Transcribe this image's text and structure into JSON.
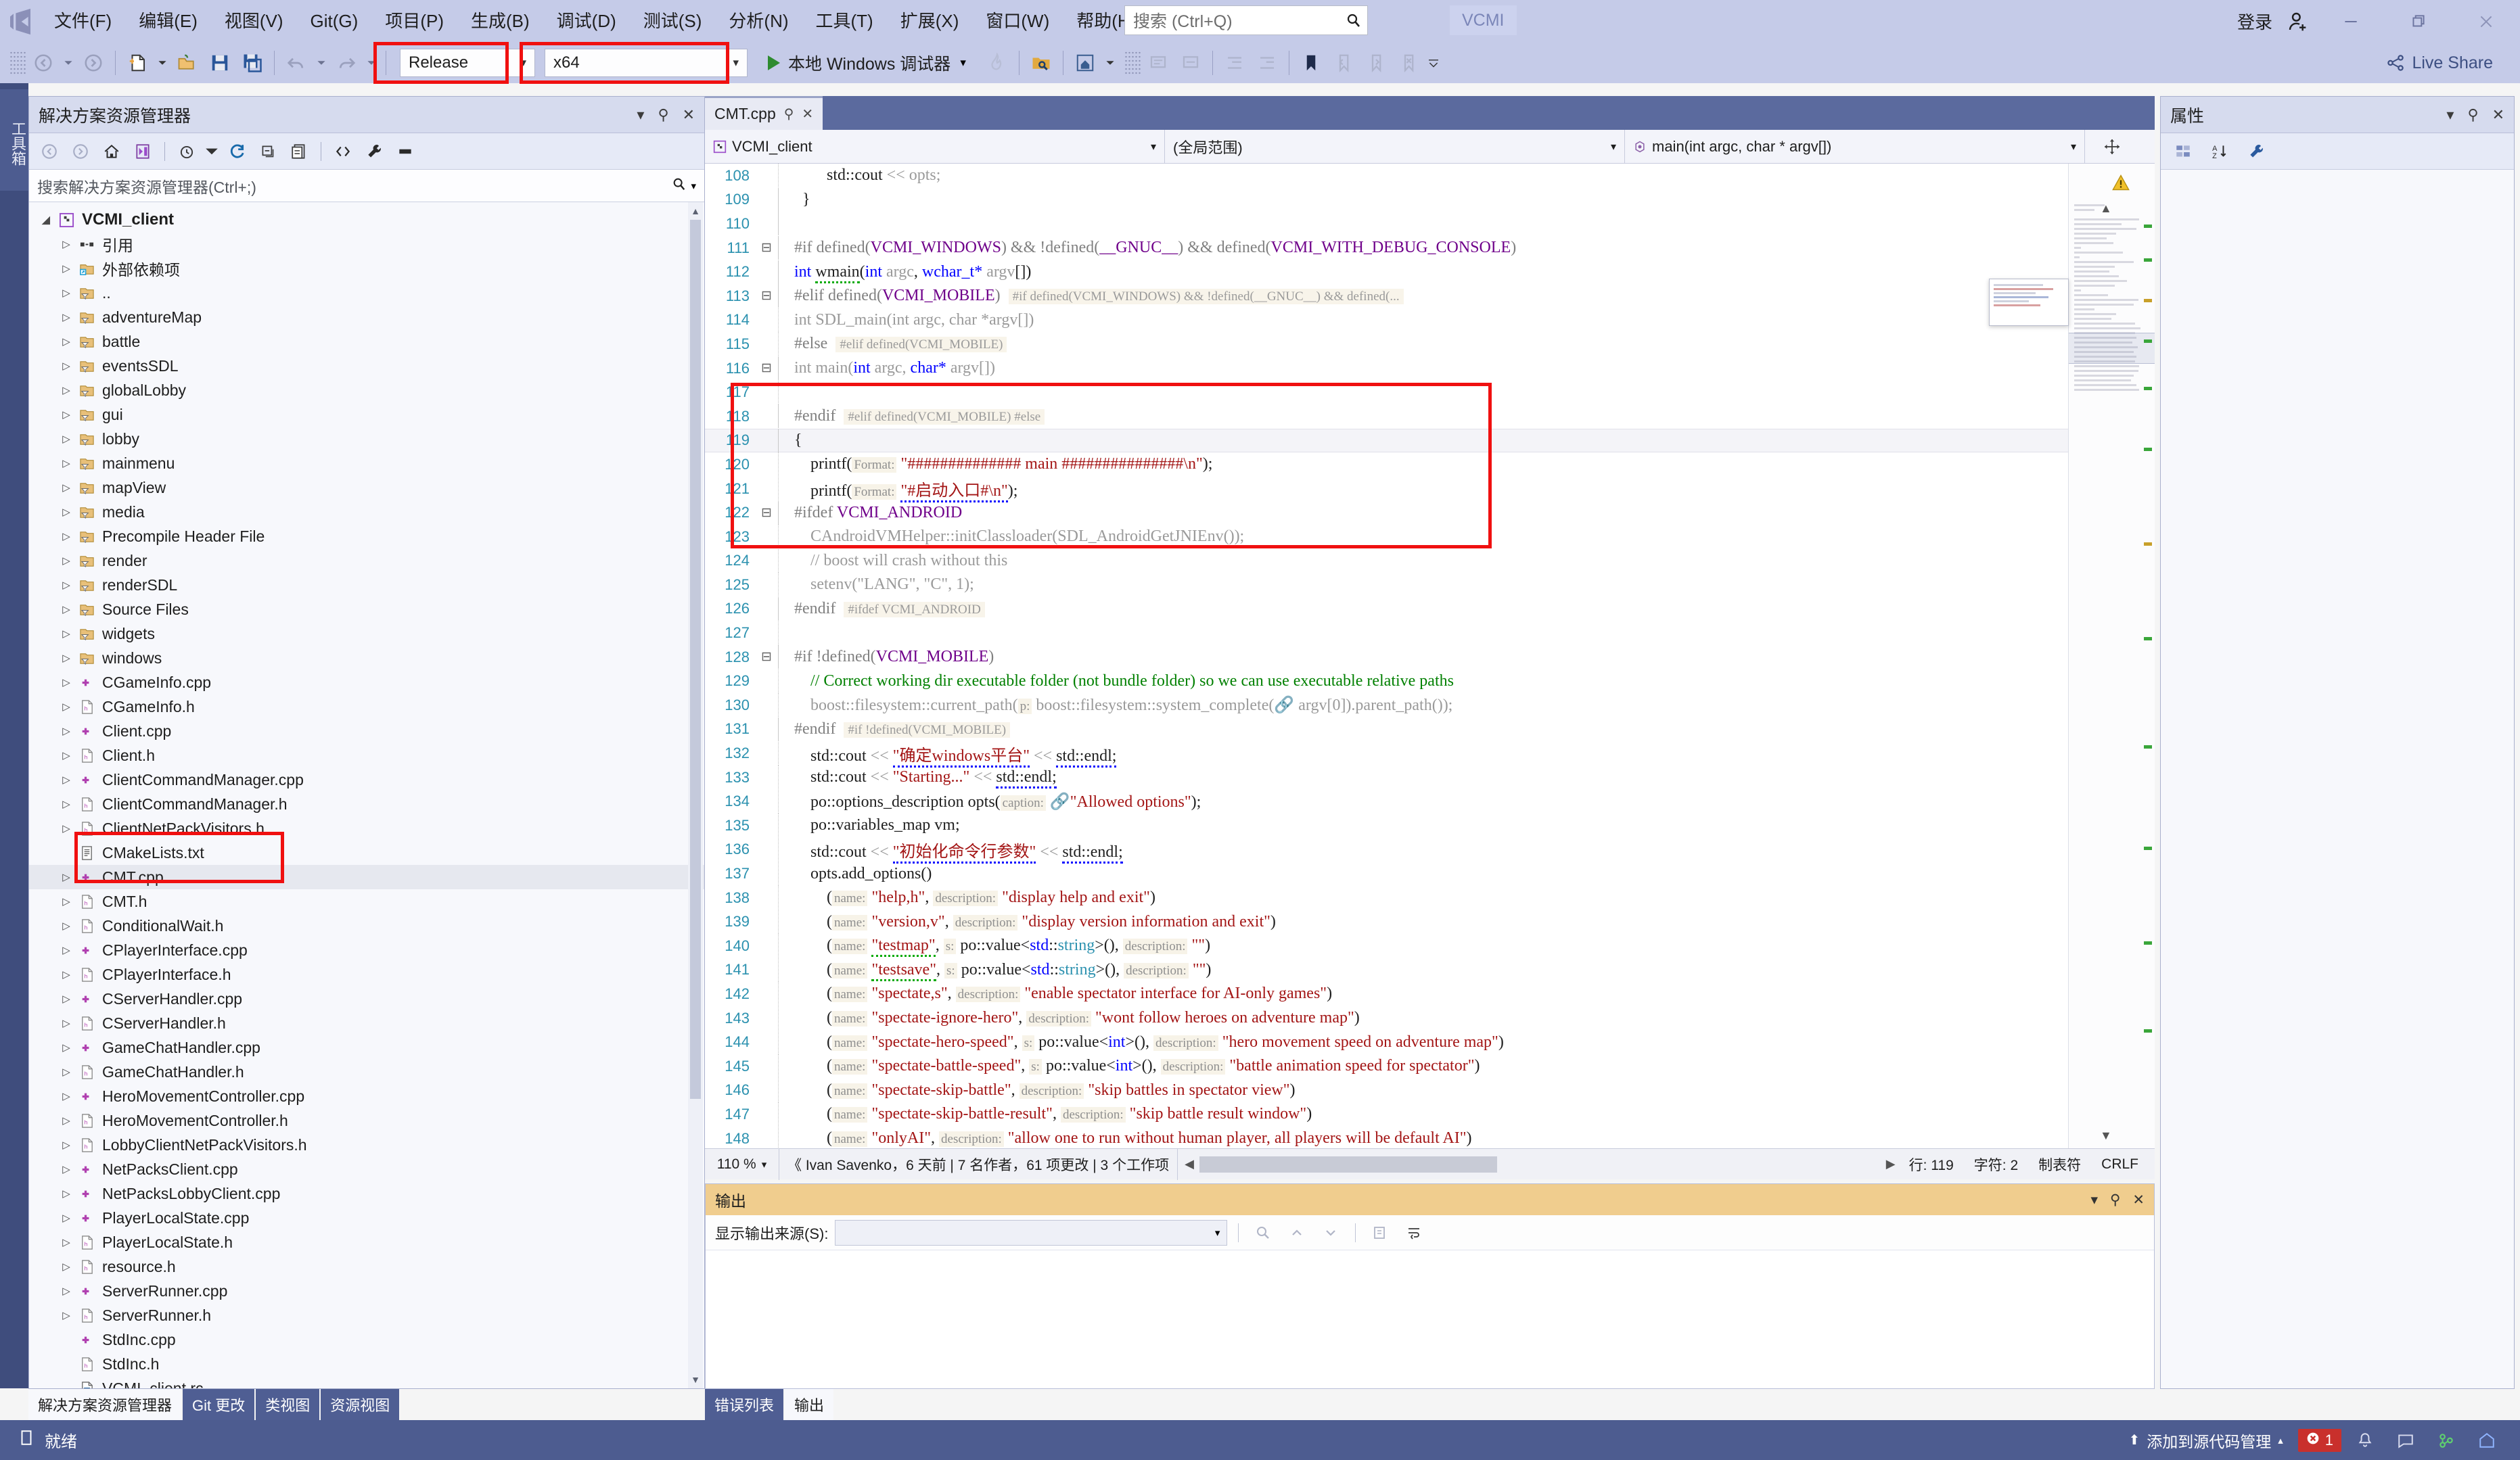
{
  "titlebar": {
    "menu": [
      "文件(F)",
      "编辑(E)",
      "视图(V)",
      "Git(G)",
      "项目(P)",
      "生成(B)",
      "调试(D)",
      "测试(S)",
      "分析(N)",
      "工具(T)",
      "扩展(X)",
      "窗口(W)",
      "帮助(H)"
    ],
    "search_placeholder": "搜索 (Ctrl+Q)",
    "project_badge": "VCMI",
    "signin": "登录",
    "window_controls": [
      "minimize",
      "restore",
      "close"
    ]
  },
  "toolbar": {
    "configuration": "Release",
    "platform": "x64",
    "run_label": "本地 Windows 调试器"
  },
  "toolbox_tab": "工具箱",
  "solution_explorer": {
    "title": "解决方案资源管理器",
    "search_placeholder": "搜索解决方案资源管理器(Ctrl+;)",
    "tree": [
      {
        "label": "VCMI_client",
        "icon": "project-icon",
        "depth": 0,
        "arrow": "open",
        "bold": true
      },
      {
        "label": "引用",
        "icon": "references-icon",
        "depth": 1,
        "arrow": "closed"
      },
      {
        "label": "外部依赖项",
        "icon": "ext-dep-icon",
        "depth": 1,
        "arrow": "closed"
      },
      {
        "label": "..",
        "icon": "filter-folder-icon",
        "depth": 1,
        "arrow": "closed"
      },
      {
        "label": "adventureMap",
        "icon": "filter-folder-icon",
        "depth": 1,
        "arrow": "closed"
      },
      {
        "label": "battle",
        "icon": "filter-folder-icon",
        "depth": 1,
        "arrow": "closed"
      },
      {
        "label": "eventsSDL",
        "icon": "filter-folder-icon",
        "depth": 1,
        "arrow": "closed"
      },
      {
        "label": "globalLobby",
        "icon": "filter-folder-icon",
        "depth": 1,
        "arrow": "closed"
      },
      {
        "label": "gui",
        "icon": "filter-folder-icon",
        "depth": 1,
        "arrow": "closed"
      },
      {
        "label": "lobby",
        "icon": "filter-folder-icon",
        "depth": 1,
        "arrow": "closed"
      },
      {
        "label": "mainmenu",
        "icon": "filter-folder-icon",
        "depth": 1,
        "arrow": "closed"
      },
      {
        "label": "mapView",
        "icon": "filter-folder-icon",
        "depth": 1,
        "arrow": "closed"
      },
      {
        "label": "media",
        "icon": "filter-folder-icon",
        "depth": 1,
        "arrow": "closed"
      },
      {
        "label": "Precompile Header File",
        "icon": "filter-folder-icon",
        "depth": 1,
        "arrow": "closed"
      },
      {
        "label": "render",
        "icon": "filter-folder-icon",
        "depth": 1,
        "arrow": "closed"
      },
      {
        "label": "renderSDL",
        "icon": "filter-folder-icon",
        "depth": 1,
        "arrow": "closed"
      },
      {
        "label": "Source Files",
        "icon": "filter-folder-icon",
        "depth": 1,
        "arrow": "closed"
      },
      {
        "label": "widgets",
        "icon": "filter-folder-icon",
        "depth": 1,
        "arrow": "closed"
      },
      {
        "label": "windows",
        "icon": "filter-folder-icon",
        "depth": 1,
        "arrow": "closed"
      },
      {
        "label": "CGameInfo.cpp",
        "icon": "cpp-file-icon",
        "depth": 1,
        "arrow": "closed"
      },
      {
        "label": "CGameInfo.h",
        "icon": "h-file-icon",
        "depth": 1,
        "arrow": "closed"
      },
      {
        "label": "Client.cpp",
        "icon": "cpp-file-icon",
        "depth": 1,
        "arrow": "closed"
      },
      {
        "label": "Client.h",
        "icon": "h-file-icon",
        "depth": 1,
        "arrow": "closed"
      },
      {
        "label": "ClientCommandManager.cpp",
        "icon": "cpp-file-icon",
        "depth": 1,
        "arrow": "closed"
      },
      {
        "label": "ClientCommandManager.h",
        "icon": "h-file-icon",
        "depth": 1,
        "arrow": "closed"
      },
      {
        "label": "ClientNetPackVisitors.h",
        "icon": "h-file-icon",
        "depth": 1,
        "arrow": "closed"
      },
      {
        "label": "CMakeLists.txt",
        "icon": "txt-file-icon",
        "depth": 1,
        "arrow": "none"
      },
      {
        "label": "CMT.cpp",
        "icon": "cpp-file-icon",
        "depth": 1,
        "arrow": "closed",
        "selected": true
      },
      {
        "label": "CMT.h",
        "icon": "h-file-icon",
        "depth": 1,
        "arrow": "closed"
      },
      {
        "label": "ConditionalWait.h",
        "icon": "h-file-icon",
        "depth": 1,
        "arrow": "closed"
      },
      {
        "label": "CPlayerInterface.cpp",
        "icon": "cpp-file-icon",
        "depth": 1,
        "arrow": "closed"
      },
      {
        "label": "CPlayerInterface.h",
        "icon": "h-file-icon",
        "depth": 1,
        "arrow": "closed"
      },
      {
        "label": "CServerHandler.cpp",
        "icon": "cpp-file-icon",
        "depth": 1,
        "arrow": "closed"
      },
      {
        "label": "CServerHandler.h",
        "icon": "h-file-icon",
        "depth": 1,
        "arrow": "closed"
      },
      {
        "label": "GameChatHandler.cpp",
        "icon": "cpp-file-icon",
        "depth": 1,
        "arrow": "closed"
      },
      {
        "label": "GameChatHandler.h",
        "icon": "h-file-icon",
        "depth": 1,
        "arrow": "closed"
      },
      {
        "label": "HeroMovementController.cpp",
        "icon": "cpp-file-icon",
        "depth": 1,
        "arrow": "closed"
      },
      {
        "label": "HeroMovementController.h",
        "icon": "h-file-icon",
        "depth": 1,
        "arrow": "closed"
      },
      {
        "label": "LobbyClientNetPackVisitors.h",
        "icon": "h-file-icon",
        "depth": 1,
        "arrow": "closed"
      },
      {
        "label": "NetPacksClient.cpp",
        "icon": "cpp-file-icon",
        "depth": 1,
        "arrow": "closed"
      },
      {
        "label": "NetPacksLobbyClient.cpp",
        "icon": "cpp-file-icon",
        "depth": 1,
        "arrow": "closed"
      },
      {
        "label": "PlayerLocalState.cpp",
        "icon": "cpp-file-icon",
        "depth": 1,
        "arrow": "closed"
      },
      {
        "label": "PlayerLocalState.h",
        "icon": "h-file-icon",
        "depth": 1,
        "arrow": "closed"
      },
      {
        "label": "resource.h",
        "icon": "h-file-icon",
        "depth": 1,
        "arrow": "closed"
      },
      {
        "label": "ServerRunner.cpp",
        "icon": "cpp-file-icon",
        "depth": 1,
        "arrow": "closed"
      },
      {
        "label": "ServerRunner.h",
        "icon": "h-file-icon",
        "depth": 1,
        "arrow": "closed"
      },
      {
        "label": "StdInc.cpp",
        "icon": "cpp-file-icon",
        "depth": 1,
        "arrow": "none"
      },
      {
        "label": "StdInc.h",
        "icon": "h-file-icon",
        "depth": 1,
        "arrow": "none"
      },
      {
        "label": "VCMI_client.rc",
        "icon": "rc-file-icon",
        "depth": 1,
        "arrow": "none"
      }
    ],
    "dock_tabs": [
      {
        "label": "解决方案资源管理器",
        "active": true
      },
      {
        "label": "Git 更改",
        "active": false
      },
      {
        "label": "类视图",
        "active": false
      },
      {
        "label": "资源视图",
        "active": false
      }
    ]
  },
  "editor": {
    "tab": "CMT.cpp",
    "nav_project": "VCMI_client",
    "nav_scope": "(全局范围)",
    "nav_member": "main(int argc, char * argv[])",
    "zoom": "110 %",
    "git_blame": "《 Ivan Savenko，6 天前 | 7 名作者，61 项更改 | 3 个工作项",
    "line_label": "行: 119",
    "col_label": "字符: 2",
    "tab_label": "制表符",
    "eol_label": "CRLF",
    "code": [
      {
        "n": "108",
        "fold": "",
        "ind": true,
        "html": "        <span class='k-plain'>std::cout</span> <span class='k-dim'>&lt;&lt;</span> <span class='k-dim'>opts;</span>"
      },
      {
        "n": "109",
        "fold": "",
        "ind": false,
        "html": "  <span class='k-plain'>}</span>"
      },
      {
        "n": "110",
        "fold": "",
        "ind": false,
        "html": ""
      },
      {
        "n": "111",
        "fold": "-",
        "ind": false,
        "html": "<span class='k-pre'>#if defined(</span><span class='k-macro'>VCMI_WINDOWS</span><span class='k-pre'>) &amp;&amp; !defined(</span><span class='k-macro'>__GNUC__</span><span class='k-pre'>) &amp;&amp; defined(</span><span class='k-macro'>VCMI_WITH_DEBUG_CONSOLE</span><span class='k-pre'>)</span>"
      },
      {
        "n": "112",
        "fold": "",
        "ind": false,
        "html": "<span class='k-kw'>int</span> <span class='k-plain sq-g'>wmain</span><span class='k-plain'>(</span><span class='k-kw'>int</span> <span class='k-dim'>argc</span><span class='k-plain'>, </span><span class='k-kw'>wchar_t*</span> <span class='k-dim'>argv</span><span class='k-plain'>[])</span>"
      },
      {
        "n": "113",
        "fold": "-",
        "ind": false,
        "html": "<span class='k-pre'>#elif defined(</span><span class='k-macro'>VCMI_MOBILE</span><span class='k-pre'>)</span>  <span class='k-inl'>#if defined(VCMI_WINDOWS) &amp;&amp; !defined(__GNUC__) &amp;&amp; defined(...</span>"
      },
      {
        "n": "114",
        "fold": "",
        "ind": true,
        "html": "<span class='k-dim'>int SDL_main(int argc, char *argv[])</span>"
      },
      {
        "n": "115",
        "fold": "",
        "ind": true,
        "html": "<span class='k-pre'>#else</span>  <span class='k-inl'>#elif defined(VCMI_MOBILE)</span>"
      },
      {
        "n": "116",
        "fold": "-",
        "ind": false,
        "html": "<span class='k-dim'>int main(</span><span class='k-kw'>int</span><span class='k-dim'> argc, </span><span class='k-kw'>char*</span><span class='k-dim'> argv[])</span>"
      },
      {
        "n": "117",
        "fold": "",
        "ind": true,
        "html": ""
      },
      {
        "n": "118",
        "fold": "",
        "ind": false,
        "html": "<span class='k-pre'>#endif</span>  <span class='k-inl'>#elif defined(VCMI_MOBILE) #else</span>"
      },
      {
        "n": "119",
        "fold": "",
        "ind": false,
        "cur": true,
        "html": "<span class='k-plain'>{</span>"
      },
      {
        "n": "120",
        "fold": "",
        "ind": true,
        "html": "    <span class='k-plain'>printf(</span><span class='k-hint'>Format:</span> <span class='k-str'>\"############## main ###############\\n\"</span><span class='k-plain'>);</span>"
      },
      {
        "n": "121",
        "fold": "",
        "ind": true,
        "html": "    <span class='k-plain'>printf(</span><span class='k-hint'>Format:</span> <span class='k-str sq-b'>\"#启动入口#\\n\"</span><span class='k-plain'>);</span>"
      },
      {
        "n": "122",
        "fold": "-",
        "ind": false,
        "html": "<span class='k-pre'>#ifdef </span><span class='k-macro'>VCMI_ANDROID</span>"
      },
      {
        "n": "123",
        "fold": "",
        "ind": true,
        "html": "    <span class='k-dim'>CAndroidVMHelper::initClassloader(SDL_AndroidGetJNIEnv());</span>"
      },
      {
        "n": "124",
        "fold": "",
        "ind": true,
        "html": "    <span class='k-dim'>// boost will crash without this</span>"
      },
      {
        "n": "125",
        "fold": "",
        "ind": true,
        "html": "    <span class='k-dim'>setenv(\"LANG\", \"C\", 1);</span>"
      },
      {
        "n": "126",
        "fold": "",
        "ind": false,
        "html": "<span class='k-pre'>#endif</span>  <span class='k-inl'>#ifdef VCMI_ANDROID</span>"
      },
      {
        "n": "127",
        "fold": "",
        "ind": true,
        "html": ""
      },
      {
        "n": "128",
        "fold": "-",
        "ind": false,
        "html": "<span class='k-pre'>#if !defined(</span><span class='k-macro'>VCMI_MOBILE</span><span class='k-pre'>)</span>"
      },
      {
        "n": "129",
        "fold": "",
        "ind": true,
        "html": "    <span class='k-com'>// Correct working dir executable folder (not bundle folder) so we can use executable relative paths</span>"
      },
      {
        "n": "130",
        "fold": "",
        "ind": true,
        "html": "    <span class='k-dim'>boost::filesystem::current_path(</span><span class='k-hint'>p:</span><span class='k-dim'> boost::filesystem::system_complete(</span><span class='k-plain'>🔗</span><span class='k-dim'> argv[0]).parent_path());</span>"
      },
      {
        "n": "131",
        "fold": "",
        "ind": false,
        "html": "<span class='k-pre'>#endif</span>  <span class='k-inl'>#if !defined(VCMI_MOBILE)</span>"
      },
      {
        "n": "132",
        "fold": "",
        "ind": true,
        "html": "    <span class='k-plain'>std::cout</span> <span class='k-dim'>&lt;&lt;</span> <span class='k-str sq-b'>\"确定windows平台\"</span> <span class='k-dim'>&lt;&lt;</span> <span class='k-plain sq-b'>std::endl;</span>"
      },
      {
        "n": "133",
        "fold": "",
        "ind": true,
        "html": "    <span class='k-plain'>std::cout</span> <span class='k-dim'>&lt;&lt;</span> <span class='k-str'>\"Starting...\"</span> <span class='k-dim'>&lt;&lt;</span> <span class='k-plain sq-b'>std::endl;</span>"
      },
      {
        "n": "134",
        "fold": "",
        "ind": true,
        "html": "    <span class='k-plain'>po::options_description opts(</span><span class='k-hint'>caption:</span> <span class='k-plain'>🔗</span><span class='k-str'>\"Allowed options\"</span><span class='k-plain'>);</span>"
      },
      {
        "n": "135",
        "fold": "",
        "ind": true,
        "html": "    <span class='k-plain'>po::variables_map vm;</span>"
      },
      {
        "n": "136",
        "fold": "",
        "ind": true,
        "html": "    <span class='k-plain'>std::cout</span> <span class='k-dim'>&lt;&lt;</span> <span class='k-str sq-b'>\"初始化命令行参数\"</span> <span class='k-dim'>&lt;&lt;</span> <span class='k-plain sq-b'>std::endl;</span>"
      },
      {
        "n": "137",
        "fold": "",
        "ind": true,
        "html": "    <span class='k-plain'>opts.add_options()</span>"
      },
      {
        "n": "138",
        "fold": "",
        "ind": true,
        "html": "        <span class='k-plain'>(</span><span class='k-hint'>name:</span> <span class='k-str'>\"help,h\"</span><span class='k-plain'>, </span><span class='k-hint'>description:</span> <span class='k-str'>\"display help and exit\"</span><span class='k-plain'>)</span>"
      },
      {
        "n": "139",
        "fold": "",
        "ind": true,
        "html": "        <span class='k-plain'>(</span><span class='k-hint'>name:</span> <span class='k-str'>\"version,v\"</span><span class='k-plain'>, </span><span class='k-hint'>description:</span> <span class='k-str'>\"display version information and exit\"</span><span class='k-plain'>)</span>"
      },
      {
        "n": "140",
        "fold": "",
        "ind": true,
        "html": "        <span class='k-plain'>(</span><span class='k-hint'>name:</span> <span class='k-str sq-g'>\"testmap\"</span><span class='k-plain'>, </span><span class='k-hint'>s:</span> <span class='k-plain'>po::value&lt;</span><span class='k-kw'>std</span><span class='k-plain'>::</span><span class='k-type'>string</span><span class='k-plain'>&gt;(), </span><span class='k-hint'>description:</span> <span class='k-str'>\"\"</span><span class='k-plain'>)</span>"
      },
      {
        "n": "141",
        "fold": "",
        "ind": true,
        "html": "        <span class='k-plain'>(</span><span class='k-hint'>name:</span> <span class='k-str sq-g'>\"testsave\"</span><span class='k-plain'>, </span><span class='k-hint'>s:</span> <span class='k-plain'>po::value&lt;</span><span class='k-kw'>std</span><span class='k-plain'>::</span><span class='k-type'>string</span><span class='k-plain'>&gt;(), </span><span class='k-hint'>description:</span> <span class='k-str'>\"\"</span><span class='k-plain'>)</span>"
      },
      {
        "n": "142",
        "fold": "",
        "ind": true,
        "html": "        <span class='k-plain'>(</span><span class='k-hint'>name:</span> <span class='k-str'>\"spectate,s\"</span><span class='k-plain'>, </span><span class='k-hint'>description:</span> <span class='k-str'>\"enable spectator interface for AI-only games\"</span><span class='k-plain'>)</span>"
      },
      {
        "n": "143",
        "fold": "",
        "ind": true,
        "html": "        <span class='k-plain'>(</span><span class='k-hint'>name:</span> <span class='k-str'>\"spectate-ignore-hero\"</span><span class='k-plain'>, </span><span class='k-hint'>description:</span> <span class='k-str'>\"wont follow heroes on adventure map\"</span><span class='k-plain'>)</span>"
      },
      {
        "n": "144",
        "fold": "",
        "ind": true,
        "html": "        <span class='k-plain'>(</span><span class='k-hint'>name:</span> <span class='k-str'>\"spectate-hero-speed\"</span><span class='k-plain'>, </span><span class='k-hint'>s:</span> <span class='k-plain'>po::value&lt;</span><span class='k-kw'>int</span><span class='k-plain'>&gt;(), </span><span class='k-hint'>description:</span> <span class='k-str'>\"hero movement speed on adventure map\"</span><span class='k-plain'>)</span>"
      },
      {
        "n": "145",
        "fold": "",
        "ind": true,
        "html": "        <span class='k-plain'>(</span><span class='k-hint'>name:</span> <span class='k-str'>\"spectate-battle-speed\"</span><span class='k-plain'>, </span><span class='k-hint'>s:</span> <span class='k-plain'>po::value&lt;</span><span class='k-kw'>int</span><span class='k-plain'>&gt;(), </span><span class='k-hint'>description:</span> <span class='k-str'>\"battle animation speed for spectator\"</span><span class='k-plain'>)</span>"
      },
      {
        "n": "146",
        "fold": "",
        "ind": true,
        "html": "        <span class='k-plain'>(</span><span class='k-hint'>name:</span> <span class='k-str'>\"spectate-skip-battle\"</span><span class='k-plain'>, </span><span class='k-hint'>description:</span> <span class='k-str'>\"skip battles in spectator view\"</span><span class='k-plain'>)</span>"
      },
      {
        "n": "147",
        "fold": "",
        "ind": true,
        "html": "        <span class='k-plain'>(</span><span class='k-hint'>name:</span> <span class='k-str'>\"spectate-skip-battle-result\"</span><span class='k-plain'>, </span><span class='k-hint'>description:</span> <span class='k-str'>\"skip battle result window\"</span><span class='k-plain'>)</span>"
      },
      {
        "n": "148",
        "fold": "",
        "ind": true,
        "html": "        <span class='k-plain'>(</span><span class='k-hint'>name:</span> <span class='k-str'>\"onlyAI\"</span><span class='k-plain'>, </span><span class='k-hint'>description:</span> <span class='k-str'>\"allow one to run without human player, all players will be default AI\"</span><span class='k-plain'>)</span>"
      }
    ]
  },
  "output": {
    "title": "输出",
    "source_label": "显示输出来源(S):",
    "source_value": "",
    "tabs": [
      {
        "label": "错误列表",
        "active": false
      },
      {
        "label": "输出",
        "active": true
      }
    ]
  },
  "properties": {
    "title": "属性"
  },
  "statusbar": {
    "ready": "就绪",
    "add_to_source_control": "添加到源代码管理",
    "error_count": "1"
  }
}
